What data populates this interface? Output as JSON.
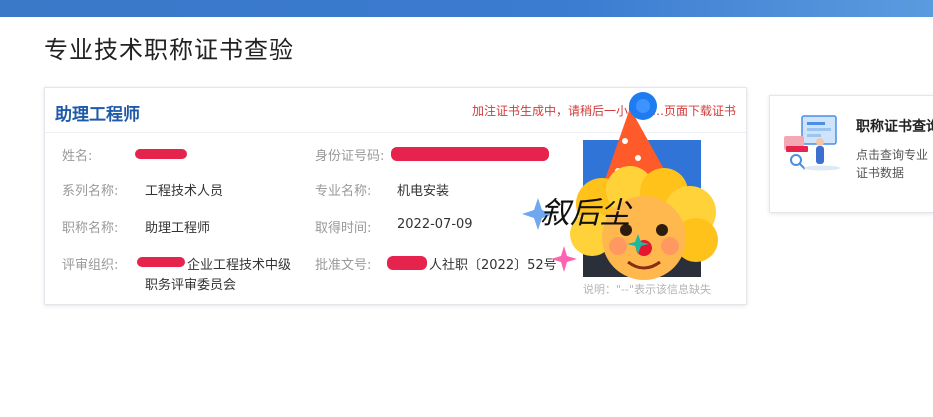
{
  "page": {
    "title": "专业技术职称证书查验"
  },
  "certificate": {
    "title": "助理工程师",
    "notice": "加注证书生成中，请稍后一小时……页面下载证书",
    "fields": {
      "name_label": "姓名:",
      "id_label": "身份证号码:",
      "series_label": "系列名称:",
      "series_value": "工程技术人员",
      "major_label": "专业名称:",
      "major_value": "机电安装",
      "title_label": "职称名称:",
      "title_value": "助理工程师",
      "date_label": "取得时间:",
      "date_value": "2022-07-09",
      "org_label": "评审组织:",
      "org_value_line1": "企业工程技术中级",
      "org_value_line2": "职务评审委员会",
      "approval_label": "批准文号:",
      "approval_value": "人社职〔2022〕52号"
    },
    "footnote": "说明：\"--\"表示该信息缺失"
  },
  "side_panel": {
    "title": "职称证书查询",
    "desc_line1": "点击查询专业",
    "desc_line2": "证书数据"
  },
  "overlay": {
    "signature": "叙后尘"
  },
  "colors": {
    "topbar": "#3a78c8",
    "card_title": "#1e5aa8",
    "notice": "#d23b3b",
    "redaction": "#e5234d",
    "photo_bg": "#2f74d6"
  }
}
